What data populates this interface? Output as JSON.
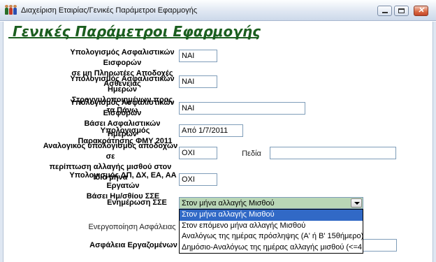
{
  "window": {
    "title": "Διαχείριση Εταιρίας/Γενικές Παράμετροι Εφαρμογής",
    "minimize_symbol": "",
    "maximize_symbol": "",
    "close_symbol": "✕",
    "icon": "people-icon"
  },
  "page": {
    "heading": "Γενικές Παράμετροι Εφαρμογής"
  },
  "fields": {
    "f1": {
      "label_line1": "Υπολογισμός Ασφαλιστικών Εισφορών",
      "label_line2": "σε μη Πληρωτέες Αποδοχές Ασθενείας",
      "value": "ΝΑΙ"
    },
    "f2": {
      "label_line1": "Υπολογισμός Ασφαλιστικών Ημερών",
      "label_line2": "Στρογγυλοποιημένων προς τα Πάνω",
      "value": "ΝΑΙ"
    },
    "f3": {
      "label_line1": "Υπολογισμός Ασφαλιστικών Εισφορών",
      "label_line2": "Βάσει Ασφαλιστικών Ημερών",
      "value": "ΝΑΙ"
    },
    "f4": {
      "label": "Υπολογισμός Παρακράτησης ΦΜΥ 2011",
      "value": "Από 1/7/2011"
    },
    "f5": {
      "label_line1": "Αναλογικός υπολογισμός αποδοχών σε",
      "label_line2": "περίπτωση αλλαγής μισθού στον ίδιο μήνα",
      "value": "ΟΧΙ",
      "fields_label": "Πεδία",
      "fields_value": ""
    },
    "f6": {
      "label_line1": "Υπολογισμός ΔΠ, ΔΧ, ΕΑ, ΑΑ Εργατών",
      "label_line2": "Βάσει Ημ/σθίου ΣΣΕ",
      "value": "ΟΧΙ"
    },
    "f7": {
      "label": "Ενημέρωση ΣΣΕ",
      "value": "Στον μήνα αλλαγής Μισθού",
      "options": [
        "Στον μήνα αλλαγής Μισθού",
        "Στον επόμενο μήνα αλλαγής Μισθού",
        "Αναλόγως της ημέρας πρόσληψης (Α' ή Β' 15θήμερο)",
        "Δημόσιο-Αναλόγως της ημέρας αλλαγής μισθού (<=4"
      ]
    },
    "f8": {
      "label": "Ενεργοποίηση Ασφάλειας"
    },
    "f9": {
      "label": "Ασφάλεια Εργαζομένων",
      "value": ""
    }
  },
  "colors": {
    "heading": "#1b5e1f",
    "combo_bg": "#b9d6b6",
    "selection": "#3169c6"
  }
}
